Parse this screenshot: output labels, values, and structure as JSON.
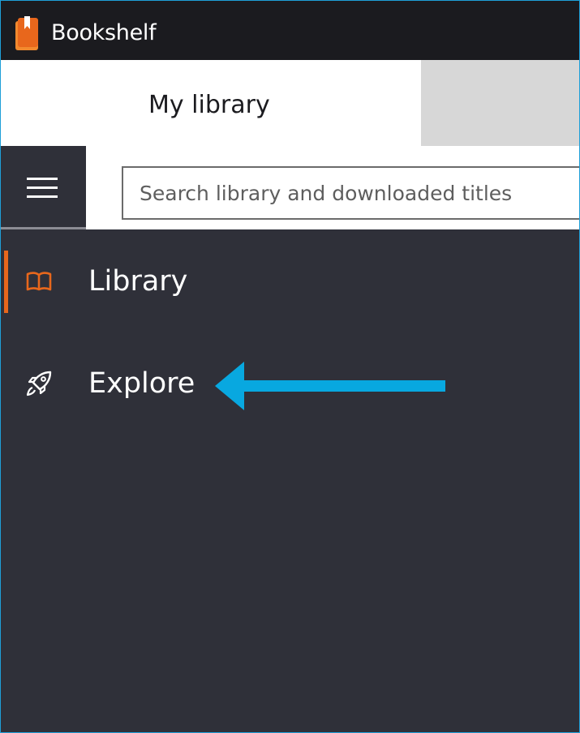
{
  "app": {
    "title": "Bookshelf"
  },
  "tabs": {
    "active_label": "My library",
    "inactive_label": ""
  },
  "search": {
    "placeholder": "Search library and downloaded titles",
    "value": ""
  },
  "nav": {
    "items": [
      {
        "label": "Library",
        "icon": "open-book-icon",
        "active": true
      },
      {
        "label": "Explore",
        "icon": "rocket-icon",
        "active": false
      }
    ]
  },
  "annotation": {
    "icon": "arrow-left-icon",
    "color": "#08a8e0"
  },
  "colors": {
    "accent": "#e8671c",
    "sidebar_bg": "#2f3039",
    "titlebar_bg": "#1b1b1f",
    "window_border": "#1f9fd8",
    "arrow": "#08a8e0"
  }
}
